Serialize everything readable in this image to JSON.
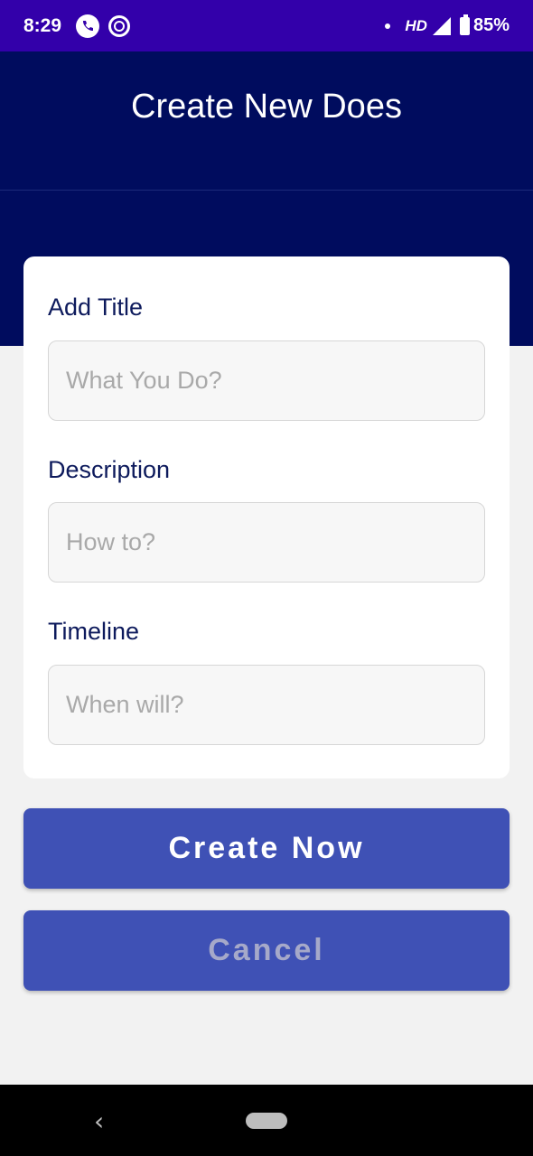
{
  "status_bar": {
    "time": "8:29",
    "network": "HD",
    "battery": "85%",
    "icons": [
      "phone-icon",
      "app-circle-icon",
      "notification-dot-icon",
      "signal-icon",
      "battery-icon"
    ]
  },
  "header": {
    "title": "Create New Does",
    "background_color": "#000c5e"
  },
  "form": {
    "title_label": "Add Title",
    "title_placeholder": "What You Do?",
    "title_value": "",
    "description_label": "Description",
    "description_placeholder": "How to?",
    "description_value": "",
    "timeline_label": "Timeline",
    "timeline_placeholder": "When will?",
    "timeline_value": ""
  },
  "actions": {
    "create_label": "Create Now",
    "cancel_label": "Cancel",
    "button_color": "#3f51b5"
  },
  "nav_bar": {
    "icons": [
      "back-icon",
      "home-pill-icon"
    ]
  }
}
